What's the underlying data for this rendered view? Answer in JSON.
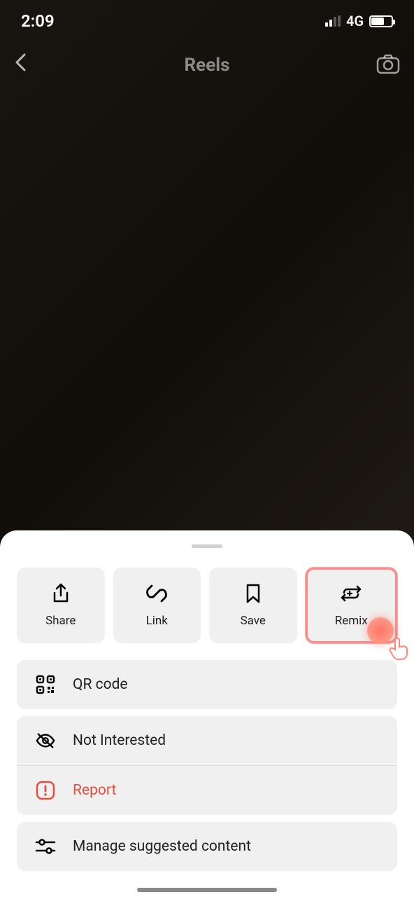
{
  "status_bar": {
    "time": "2:09",
    "network": "4G"
  },
  "nav": {
    "title": "Reels"
  },
  "actions": {
    "share": "Share",
    "link": "Link",
    "save": "Save",
    "remix": "Remix"
  },
  "menu": {
    "qr_code": "QR code",
    "not_interested": "Not Interested",
    "report": "Report",
    "manage_content": "Manage suggested content"
  }
}
